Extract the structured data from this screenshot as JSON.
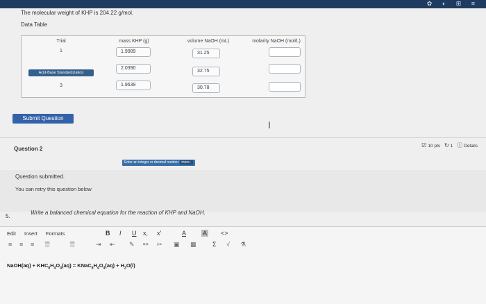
{
  "header": {
    "molecular_weight_text": "The molecular weight of KHP is 204.22 g/mol.",
    "data_table_title": "Data Table"
  },
  "table": {
    "columns": [
      "Trial",
      "mass KHP (g)",
      "volume NaOH (mL)",
      "molarity NaOH (mol/L)"
    ],
    "rows": [
      {
        "trial": "1",
        "mass": "1.9989",
        "volume": "31.25"
      },
      {
        "trial": "Acid-Base Standardization",
        "mass": "2.0390",
        "volume": "32.75"
      },
      {
        "trial": "3",
        "mass": "1.9639",
        "volume": "30.78"
      }
    ]
  },
  "submit_label": "Submit Question",
  "question2": {
    "title": "Question 2",
    "points": "10 pts",
    "retries": "1",
    "details": "Details",
    "hint": "Enter an integer or decimal number",
    "hint_more": "more..",
    "submitted": "Question submitted.",
    "retry": "You can retry this question below"
  },
  "question5": {
    "number": "5.",
    "prompt": "Write a balanced chemical equation for the reaction of KHP and NaOH."
  },
  "editor": {
    "menu": [
      "Edit",
      "Insert",
      "Formats"
    ],
    "toolbar": [
      "B",
      "I",
      "U",
      "x,",
      "x'",
      "A",
      "A",
      "<>"
    ],
    "sigma": "Σ"
  }
}
